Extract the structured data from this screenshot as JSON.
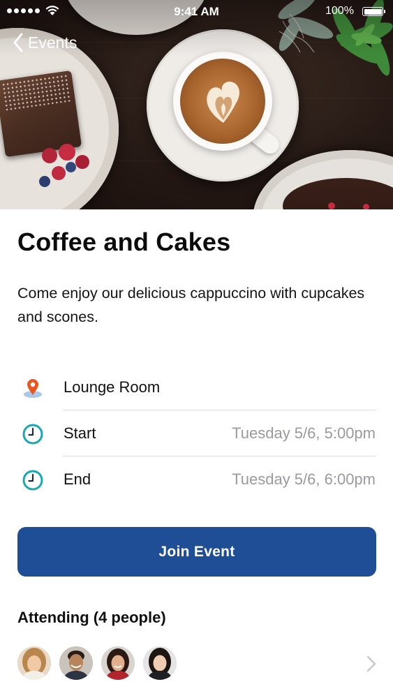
{
  "status_bar": {
    "time": "9:41 AM",
    "battery_percent": "100%",
    "battery_level": 1.0,
    "signal_bars": 5,
    "icons": [
      "signal-dots-icon",
      "wifi-icon",
      "battery-icon"
    ]
  },
  "nav": {
    "back_label": "Events",
    "back_icon": "chevron-left-icon"
  },
  "event": {
    "title": "Coffee and Cakes",
    "description": "Come enjoy our delicious cappuccino with cupcakes and scones.",
    "details": [
      {
        "icon": "location-pin-icon",
        "label": "Lounge Room",
        "value": ""
      },
      {
        "icon": "clock-icon",
        "label": "Start",
        "value": "Tuesday 5/6, 5:00pm"
      },
      {
        "icon": "clock-icon",
        "label": "End",
        "value": "Tuesday 5/6, 6:00pm"
      }
    ]
  },
  "actions": {
    "join_label": "Join Event"
  },
  "attending": {
    "heading": "Attending (4 people)",
    "avatars": [
      "avatar-1",
      "avatar-2",
      "avatar-3",
      "avatar-4"
    ],
    "more_icon": "chevron-right-icon"
  },
  "colors": {
    "accent": "#1f4e96",
    "pin": "#e8571f",
    "clock": "#1aa7b8",
    "secondary_text": "#9a9a9f"
  }
}
